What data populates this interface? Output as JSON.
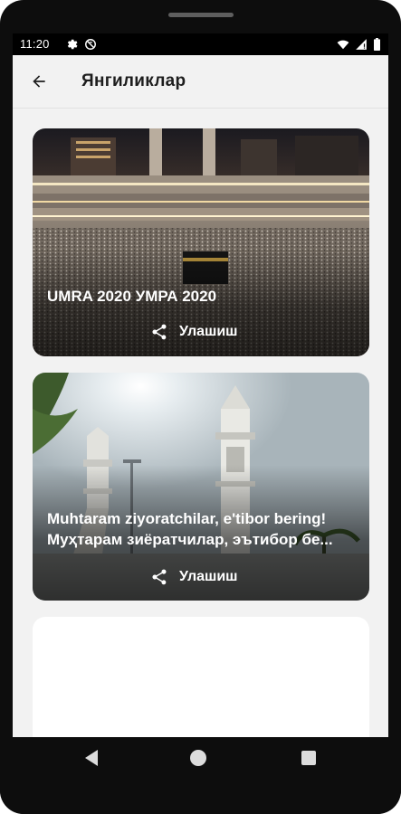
{
  "status_bar": {
    "time": "11:20",
    "left_icons": [
      "settings-icon",
      "no-sync-icon"
    ],
    "right_icons": [
      "wifi-icon",
      "signal-icon",
      "battery-icon"
    ]
  },
  "app_bar": {
    "back_icon": "arrow-back-icon",
    "title": "Янгиликлар"
  },
  "news": [
    {
      "title": "UMRA 2020 УМРА 2020",
      "share_label": "Улашиш",
      "image": "kaaba-mecca-photo"
    },
    {
      "title_line1": "Muhtaram ziyoratchilar, e'tibor bering!",
      "title_line2": "Муҳтарам зиёратчилар, эътибор бе...",
      "share_label": "Улашиш",
      "image": "minarets-photo"
    },
    {
      "title": "",
      "image": "loading-placeholder"
    }
  ],
  "nav_bar": {
    "back": "nav-back-icon",
    "home": "nav-home-icon",
    "recent": "nav-recent-icon"
  },
  "colors": {
    "screen_bg": "#f2f2f2",
    "title_text": "#1d1d1d",
    "overlay_text": "#ffffff",
    "device_frame": "#0d0d0d"
  }
}
